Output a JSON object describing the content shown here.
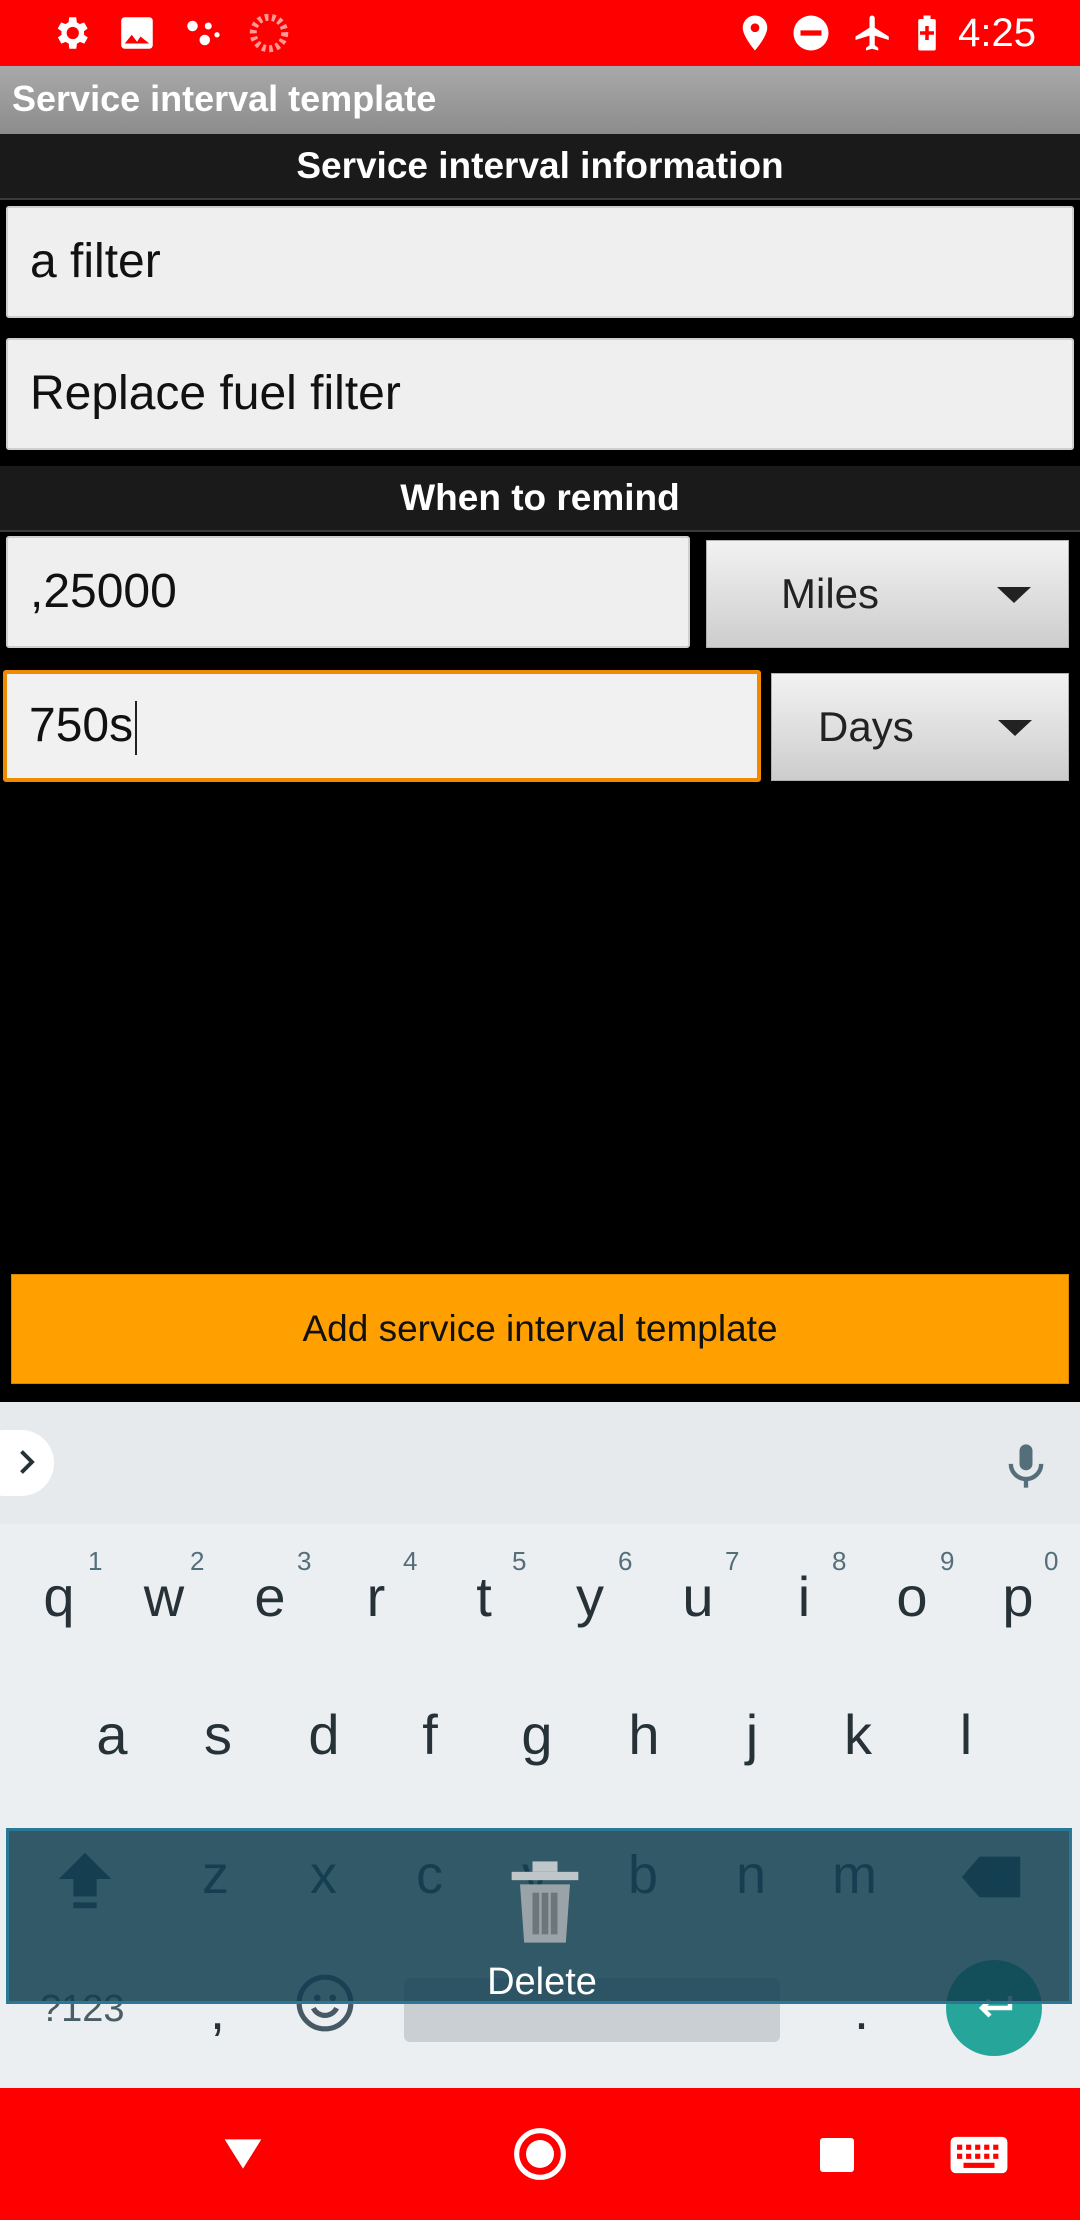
{
  "status_bar": {
    "time": "4:25",
    "left_icons": [
      "settings-icon",
      "gallery-icon",
      "assistant-icon",
      "loading-icon"
    ],
    "right_icons": [
      "location-icon",
      "do-not-disturb-icon",
      "airplane-mode-icon",
      "battery-charging-icon"
    ],
    "background": "#ff0000"
  },
  "title_bar": {
    "title": "Service interval template"
  },
  "info_section": {
    "header": "Service interval information",
    "name_value": "a filter",
    "description_value": "Replace fuel filter"
  },
  "remind_section": {
    "header": "When to remind",
    "distance_value": ",25000",
    "distance_unit": "Miles",
    "time_value": "750s",
    "time_unit": "Days"
  },
  "add_button": {
    "label": "Add service interval template",
    "color": "#ffa000"
  },
  "keyboard": {
    "row1": [
      {
        "k": "q",
        "h": "1"
      },
      {
        "k": "w",
        "h": "2"
      },
      {
        "k": "e",
        "h": "3"
      },
      {
        "k": "r",
        "h": "4"
      },
      {
        "k": "t",
        "h": "5"
      },
      {
        "k": "y",
        "h": "6"
      },
      {
        "k": "u",
        "h": "7"
      },
      {
        "k": "i",
        "h": "8"
      },
      {
        "k": "o",
        "h": "9"
      },
      {
        "k": "p",
        "h": "0"
      }
    ],
    "row2": [
      "a",
      "s",
      "d",
      "f",
      "g",
      "h",
      "j",
      "k",
      "l"
    ],
    "row3": [
      "z",
      "x",
      "c",
      "v",
      "b",
      "n",
      "m"
    ],
    "symbols_key": "?123",
    "comma_key": ",",
    "period_key": ".",
    "delete_label": "Delete"
  },
  "nav_bar": {
    "background": "#ff0000"
  }
}
